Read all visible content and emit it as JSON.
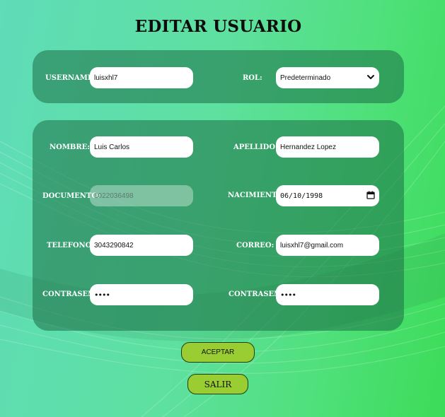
{
  "page": {
    "title": "EDITAR USUARIO"
  },
  "account": {
    "username_label": "USERNAME:",
    "username_value": "luisxhl7",
    "rol_label": "ROL:",
    "rol_selected": "Predeterminado"
  },
  "profile": {
    "nombre_label": "NOMBRE:",
    "nombre_value": "Luis Carlos",
    "apellido_label": "APELLIDO:",
    "apellido_value": "Hernandez Lopez",
    "documento_label": "DOCUMENTO:",
    "documento_value": "1022036498",
    "nacimiento_label": "NACIMIENTO:",
    "nacimiento_value": "06/10/1998",
    "telefono_label": "TELEFONO:",
    "telefono_value": "3043290842",
    "correo_label": "CORREO:",
    "correo_value": "luisxhl7@gmail.com",
    "contrasena_label": "CONTRASEÑA:",
    "contrasena_value": "••••",
    "contrasena_confirm_label": "CONTRASEÑA:",
    "contrasena_confirm_value": "••••"
  },
  "actions": {
    "aceptar_label": "ACEPTAR",
    "salir_label": "SALIR"
  },
  "icons": {
    "select": "chevron-down-icon",
    "date": "calendar-icon"
  },
  "colors": {
    "button_bg": "#9acd32",
    "panel_bg": "rgba(28,110,70,0.55)"
  }
}
